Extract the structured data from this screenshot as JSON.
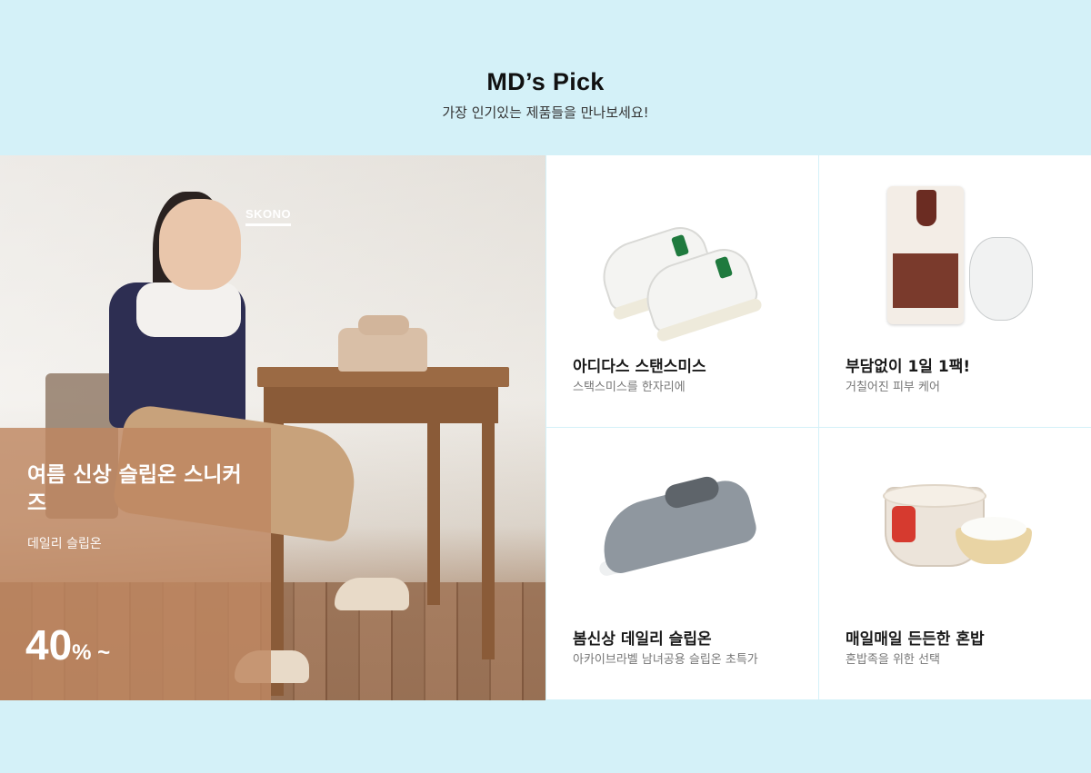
{
  "header": {
    "title": "MD’s Pick",
    "subtitle": "가장 인기있는 제품들을 만나보세요!"
  },
  "hero": {
    "brand": "SKONO",
    "title": "여름 신상 슬립온 스니커즈",
    "subtitle": "데일리 슬립온",
    "discount_value": "40",
    "discount_unit": "% ~"
  },
  "products": [
    {
      "name": "아디다스 스탠스미스",
      "desc": "스택스미스를 한자리에",
      "icon": "sneakers-icon"
    },
    {
      "name": "부담없이 1일 1팩!",
      "desc": "거칠어진 피부 케어",
      "icon": "face-mask-icon"
    },
    {
      "name": "봄신상 데일리 슬립온",
      "desc": "아카이브라벨 남녀공용 슬립온 초특가",
      "icon": "slip-on-icon"
    },
    {
      "name": "매일매일 든든한 혼밥",
      "desc": "혼밥족을 위한 선택",
      "icon": "rice-bowl-icon"
    }
  ],
  "colors": {
    "background": "#d4f1f8",
    "promo_overlay": "#be8660",
    "sneaker_accent": "#1f7a3e"
  }
}
